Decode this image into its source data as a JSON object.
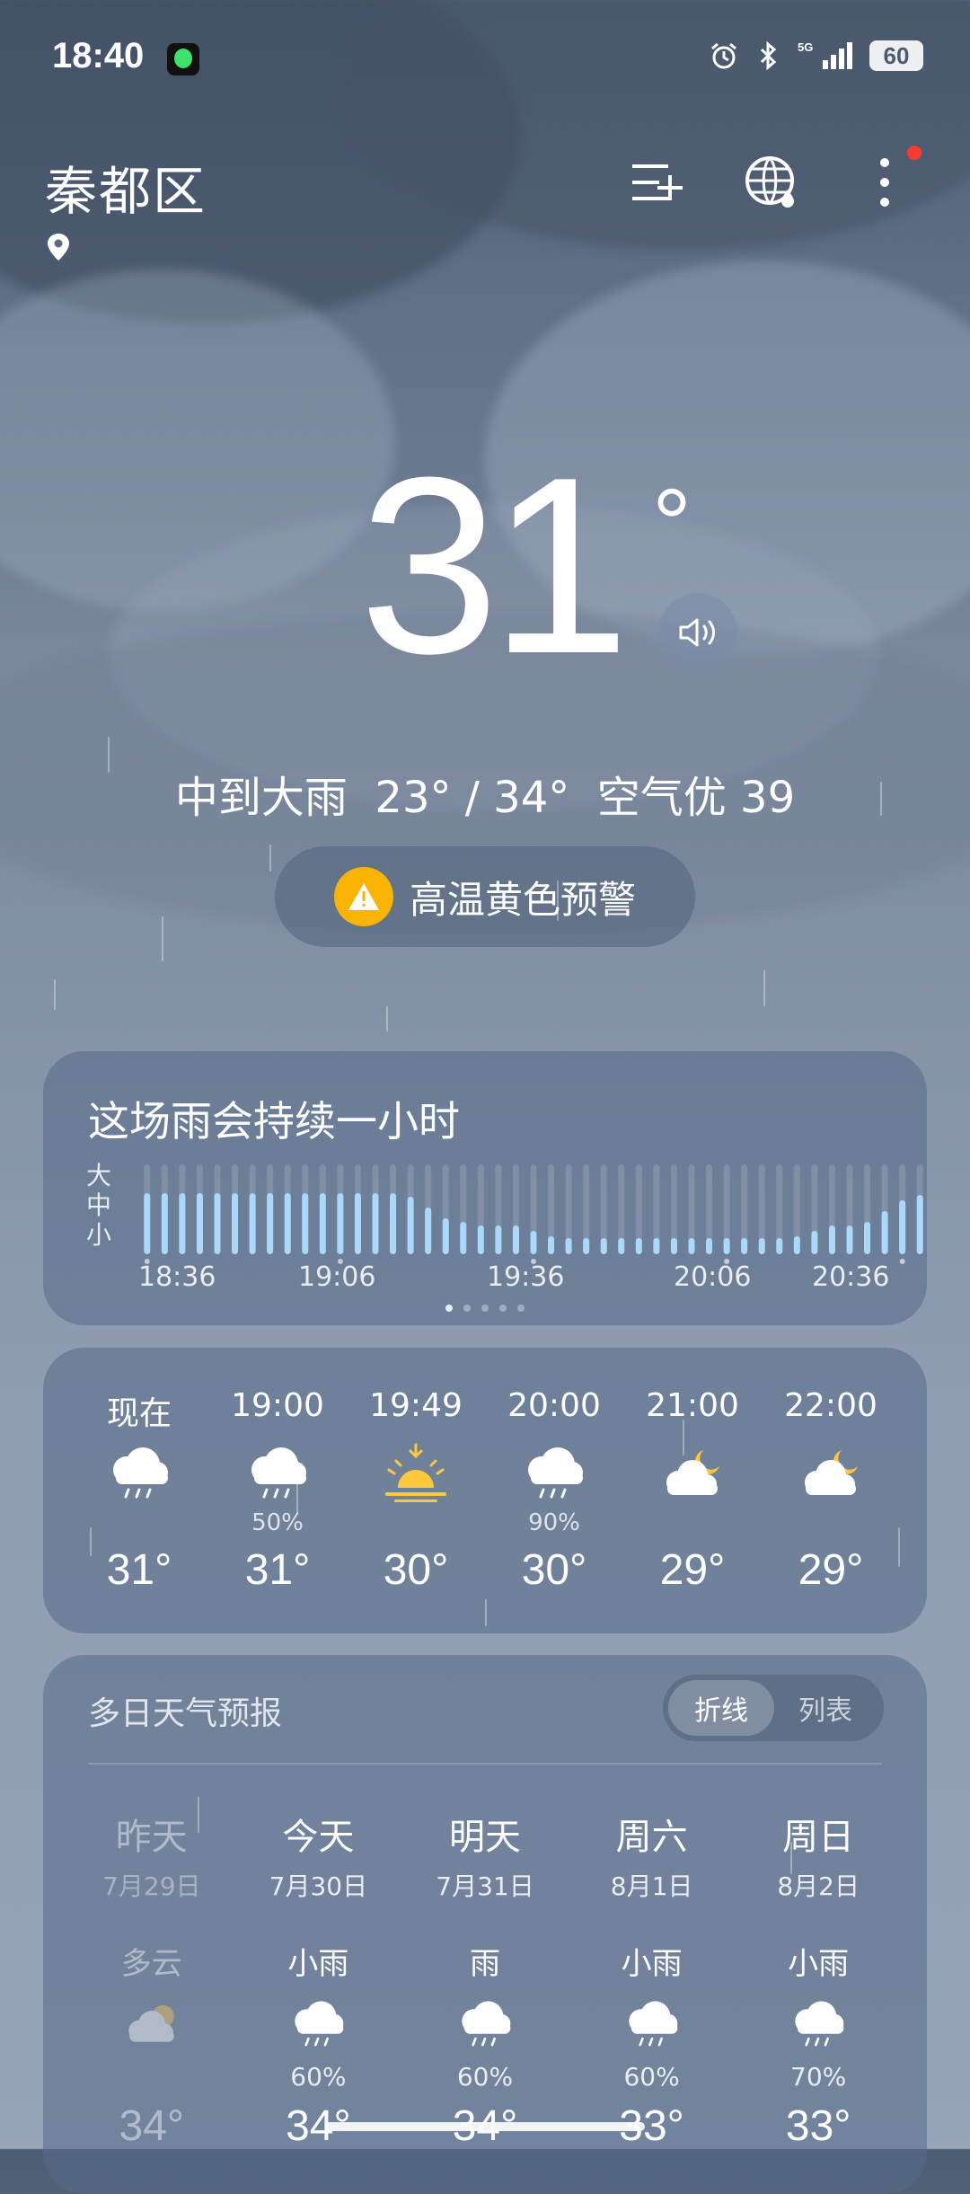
{
  "status_bar": {
    "time": "18:40",
    "network": "5G",
    "battery": "60"
  },
  "header": {
    "city": "秦都区"
  },
  "current": {
    "temperature": "31",
    "degree_symbol": "°",
    "summary": "中到大雨  23° / 34°  空气优 39",
    "warning": "高温黄色预警"
  },
  "rain_card": {
    "title": "这场雨会持续一小时",
    "scale": [
      "大",
      "中",
      "小"
    ],
    "ticks": [
      "18:36",
      "19:06",
      "19:36",
      "20:06",
      "20:36"
    ],
    "intensity": [
      0.34,
      0.34,
      0.34,
      0.34,
      0.34,
      0.34,
      0.34,
      0.34,
      0.34,
      0.34,
      0.34,
      0.34,
      0.34,
      0.34,
      0.34,
      0.32,
      0.26,
      0.2,
      0.18,
      0.16,
      0.16,
      0.16,
      0.13,
      0.1,
      0.09,
      0.09,
      0.09,
      0.09,
      0.09,
      0.09,
      0.09,
      0.09,
      0.09,
      0.09,
      0.09,
      0.09,
      0.09,
      0.1,
      0.13,
      0.16,
      0.16,
      0.18,
      0.24,
      0.3,
      0.33
    ],
    "page_count": 5,
    "page_active": 0
  },
  "hourly": [
    {
      "time": "现在",
      "icon": "rain-cloud-icon",
      "prob": "",
      "temp": "31°"
    },
    {
      "time": "19:00",
      "icon": "rain-cloud-icon",
      "prob": "50%",
      "temp": "31°"
    },
    {
      "time": "19:49",
      "icon": "sunset-icon",
      "prob": "",
      "temp": "30°"
    },
    {
      "time": "20:00",
      "icon": "rain-cloud-icon",
      "prob": "90%",
      "temp": "30°"
    },
    {
      "time": "21:00",
      "icon": "cloudy-night-icon",
      "prob": "",
      "temp": "29°"
    },
    {
      "time": "22:00",
      "icon": "cloudy-night-icon",
      "prob": "",
      "temp": "29°"
    }
  ],
  "daily_card": {
    "title": "多日天气预报",
    "toggle_on": "折线",
    "toggle_off": "列表",
    "days": [
      {
        "name": "昨天",
        "date": "7月29日",
        "cond": "多云",
        "icon": "cloudy-icon",
        "prob": "",
        "high": "34°",
        "past": true
      },
      {
        "name": "今天",
        "date": "7月30日",
        "cond": "小雨",
        "icon": "rain-cloud-icon",
        "prob": "60%",
        "high": "34°",
        "past": false
      },
      {
        "name": "明天",
        "date": "7月31日",
        "cond": "雨",
        "icon": "rain-cloud-icon",
        "prob": "60%",
        "high": "34°",
        "past": false
      },
      {
        "name": "周六",
        "date": "8月1日",
        "cond": "小雨",
        "icon": "rain-cloud-icon",
        "prob": "60%",
        "high": "33°",
        "past": false
      },
      {
        "name": "周日",
        "date": "8月2日",
        "cond": "小雨",
        "icon": "rain-cloud-icon",
        "prob": "70%",
        "high": "33°",
        "past": false
      }
    ]
  },
  "colors": {
    "bar": "#a9d8fb",
    "warning": "#f8b400",
    "sun": "#ffc83a",
    "notification_dot": "#ff3b30"
  }
}
